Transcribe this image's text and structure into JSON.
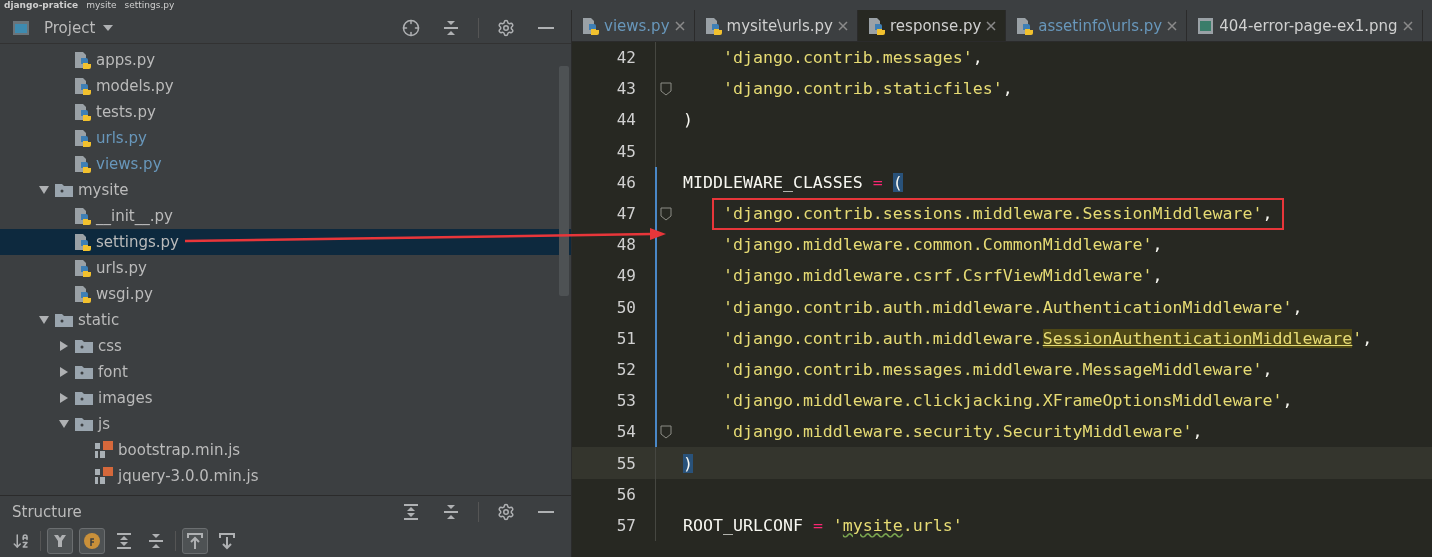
{
  "breadcrumb": [
    {
      "label": "django-pratice",
      "kind": "project"
    },
    {
      "label": "mysite",
      "kind": "folder"
    },
    {
      "label": "settings.py",
      "kind": "py"
    }
  ],
  "project_panel": {
    "title": "Project"
  },
  "tree": {
    "partial_folder_children": [
      {
        "label": "apps.py",
        "kind": "py",
        "modified": false,
        "selected": false
      },
      {
        "label": "models.py",
        "kind": "py",
        "modified": false,
        "selected": false
      },
      {
        "label": "tests.py",
        "kind": "py",
        "modified": false,
        "selected": false
      },
      {
        "label": "urls.py",
        "kind": "py",
        "modified": true,
        "selected": false
      },
      {
        "label": "views.py",
        "kind": "py",
        "modified": true,
        "selected": false
      }
    ],
    "items": [
      {
        "label": "mysite",
        "kind": "folder",
        "expanded": true,
        "selected": false,
        "children": [
          {
            "label": "__init__.py",
            "kind": "py",
            "modified": false,
            "selected": false
          },
          {
            "label": "settings.py",
            "kind": "py",
            "modified": false,
            "selected": true
          },
          {
            "label": "urls.py",
            "kind": "py",
            "modified": false,
            "selected": false
          },
          {
            "label": "wsgi.py",
            "kind": "py",
            "modified": false,
            "selected": false
          }
        ]
      },
      {
        "label": "static",
        "kind": "folder",
        "expanded": true,
        "selected": false,
        "children": [
          {
            "label": "css",
            "kind": "folder",
            "expanded": false,
            "selected": false
          },
          {
            "label": "font",
            "kind": "folder",
            "expanded": false,
            "selected": false
          },
          {
            "label": "images",
            "kind": "folder",
            "expanded": false,
            "selected": false
          },
          {
            "label": "js",
            "kind": "folder",
            "expanded": true,
            "selected": false,
            "children": [
              {
                "label": "bootstrap.min.js",
                "kind": "js",
                "modified": false,
                "selected": false
              },
              {
                "label": "jquery-3.0.0.min.js",
                "kind": "js",
                "modified": false,
                "selected": false
              }
            ]
          }
        ]
      }
    ]
  },
  "structure_panel": {
    "title": "Structure",
    "tools": [
      {
        "kind": "sort",
        "on": false
      },
      {
        "kind": "inherited",
        "on": true
      },
      {
        "kind": "fields",
        "on": true
      },
      {
        "kind": "expand",
        "on": false
      },
      {
        "kind": "collapse",
        "on": false
      },
      {
        "kind": "scroll-from",
        "on": true
      },
      {
        "kind": "scroll-to",
        "on": false
      }
    ]
  },
  "tabs": [
    {
      "label": "views.py",
      "kind": "py",
      "modified": true,
      "selected": false
    },
    {
      "label": "mysite\\urls.py",
      "kind": "py",
      "modified": false,
      "selected": false
    },
    {
      "label": "response.py",
      "kind": "py",
      "modified": false,
      "selected": true
    },
    {
      "label": "assetinfo\\urls.py",
      "kind": "py",
      "modified": true,
      "selected": false
    },
    {
      "label": "404-error-page-ex1.png",
      "kind": "image",
      "modified": false,
      "selected": false
    }
  ],
  "code": [
    {
      "number": "42",
      "indent": true,
      "fold": false,
      "scope": false,
      "current": false,
      "boxed": false,
      "tokens": [
        {
          "text": "'django.contrib.messages'",
          "kind": "string"
        },
        {
          "text": ",",
          "kind": "text"
        }
      ]
    },
    {
      "number": "43",
      "indent": true,
      "fold": true,
      "scope": false,
      "current": false,
      "boxed": false,
      "tokens": [
        {
          "text": "'django.contrib.staticfiles'",
          "kind": "string"
        },
        {
          "text": ",",
          "kind": "text"
        }
      ]
    },
    {
      "number": "44",
      "indent": false,
      "fold": false,
      "scope": false,
      "current": false,
      "boxed": false,
      "tokens": [
        {
          "text": ")",
          "kind": "text"
        }
      ]
    },
    {
      "number": "45",
      "fold": false,
      "scope": false,
      "current": false,
      "boxed": false
    },
    {
      "number": "46",
      "indent": false,
      "fold": false,
      "scope": true,
      "current": false,
      "boxed": false,
      "tokens": [
        {
          "text": "MIDDLEWARE_CLASSES",
          "kind": "text"
        },
        {
          "text": "=",
          "kind": "operator"
        },
        {
          "text": "(",
          "kind": "brace"
        }
      ]
    },
    {
      "number": "47",
      "indent": true,
      "fold": true,
      "scope": true,
      "current": false,
      "boxed": true,
      "tokens": [
        {
          "text": "'django.contrib.sessions.middleware.SessionMiddleware'",
          "kind": "string"
        },
        {
          "text": ",",
          "kind": "text"
        }
      ]
    },
    {
      "number": "48",
      "indent": true,
      "fold": false,
      "scope": true,
      "current": false,
      "boxed": false,
      "tokens": [
        {
          "text": "'django.middleware.common.CommonMiddleware'",
          "kind": "string"
        },
        {
          "text": ",",
          "kind": "text"
        }
      ]
    },
    {
      "number": "49",
      "indent": true,
      "fold": false,
      "scope": true,
      "current": false,
      "boxed": false,
      "tokens": [
        {
          "text": "'django.middleware.csrf.CsrfViewMiddleware'",
          "kind": "string"
        },
        {
          "text": ",",
          "kind": "text"
        }
      ]
    },
    {
      "number": "50",
      "indent": true,
      "fold": false,
      "scope": true,
      "current": false,
      "boxed": false,
      "tokens": [
        {
          "text": "'django.contrib.auth.middleware.AuthenticationMiddleware'",
          "kind": "string"
        },
        {
          "text": ",",
          "kind": "text"
        }
      ]
    },
    {
      "number": "51",
      "indent": true,
      "fold": false,
      "scope": true,
      "current": false,
      "boxed": false,
      "tokens": [
        {
          "text": "'django.contrib.auth.middleware.",
          "kind": "string"
        },
        {
          "text": "SessionAuthenticationMiddleware",
          "kind": "usage"
        },
        {
          "text": "'",
          "kind": "string"
        },
        {
          "text": ",",
          "kind": "text"
        }
      ]
    },
    {
      "number": "52",
      "indent": true,
      "fold": false,
      "scope": true,
      "current": false,
      "boxed": false,
      "tokens": [
        {
          "text": "'django.contrib.messages.middleware.MessageMiddleware'",
          "kind": "string"
        },
        {
          "text": ",",
          "kind": "text"
        }
      ]
    },
    {
      "number": "53",
      "indent": true,
      "fold": false,
      "scope": true,
      "current": false,
      "boxed": false,
      "tokens": [
        {
          "text": "'django.middleware.clickjacking.XFrameOptionsMiddleware'",
          "kind": "string"
        },
        {
          "text": ",",
          "kind": "text"
        }
      ]
    },
    {
      "number": "54",
      "indent": true,
      "fold": true,
      "scope": true,
      "current": false,
      "boxed": false,
      "tokens": [
        {
          "text": "'django.middleware.security.SecurityMiddleware'",
          "kind": "string"
        },
        {
          "text": ",",
          "kind": "text"
        }
      ]
    },
    {
      "number": "55",
      "indent": false,
      "fold": false,
      "scope": false,
      "current": true,
      "boxed": false,
      "tokens": [
        {
          "text": ")",
          "kind": "brace"
        }
      ]
    },
    {
      "number": "56",
      "fold": false,
      "scope": false,
      "current": false,
      "boxed": false
    },
    {
      "number": "57",
      "indent": false,
      "fold": false,
      "scope": false,
      "current": false,
      "boxed": false,
      "tokens": [
        {
          "text": "ROOT_URLCONF",
          "kind": "text"
        },
        {
          "text": "=",
          "kind": "operator"
        },
        {
          "text": "'",
          "kind": "string"
        },
        {
          "text": "mysite",
          "kind": "typo"
        },
        {
          "text": ".urls'",
          "kind": "string"
        }
      ]
    }
  ]
}
